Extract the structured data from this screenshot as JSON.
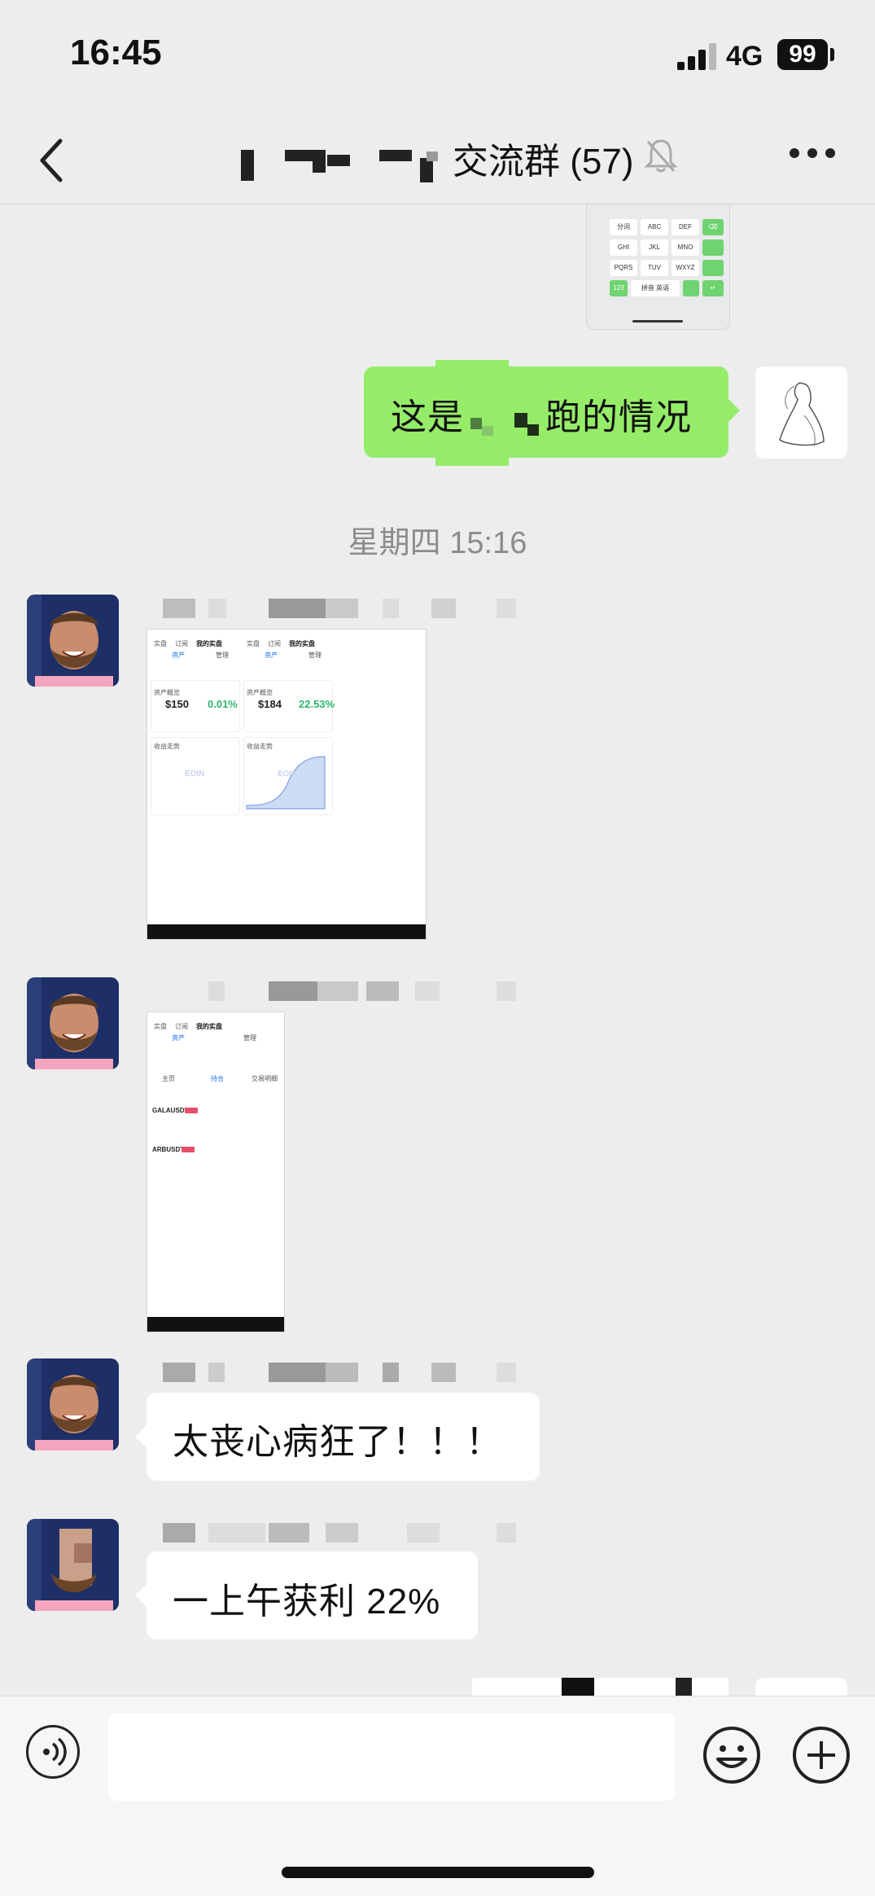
{
  "status_bar": {
    "time": "16:45",
    "network": "4G",
    "battery": "99"
  },
  "header": {
    "title": "交流群 (57)"
  },
  "messages": {
    "sent_text_before": "这是",
    "sent_text_after": "跑的情况",
    "timestamp": "星期四 15:16",
    "bubble_1": "太丧心病狂了！！！",
    "bubble_2": "一上午获利 22%"
  },
  "keyboard_keys": [
    "分词",
    "ABC",
    "DEF",
    "GHI",
    "JKL",
    "MNO",
    "PQRS",
    "TUV",
    "WXYZ",
    "123",
    "拼音 英语"
  ],
  "shot1": {
    "tabs": [
      "实盘",
      "订阅",
      "我的实盘"
    ],
    "sub_tabs": [
      "资产",
      "管理"
    ],
    "left_panel": {
      "overview_label": "资产概览",
      "total": "$150",
      "return": "0.01%",
      "chart_label": "收益走势"
    },
    "right_panel": {
      "overview_label": "资产概览",
      "total": "$184",
      "return": "22.53%",
      "chart_label": "收益走势"
    },
    "watermark": "EOIN",
    "accent_color": "#1a73e8",
    "positive_color": "#2bb673"
  },
  "shot2": {
    "tabs": [
      "实盘",
      "订阅",
      "我的实盘"
    ],
    "sub_tabs": [
      "资产",
      "管理"
    ],
    "sections": [
      "主页",
      "持仓",
      "交易明细"
    ],
    "pairs": [
      "GALAUSDT",
      "ARBUSDT"
    ]
  },
  "input": {
    "placeholder": ""
  }
}
